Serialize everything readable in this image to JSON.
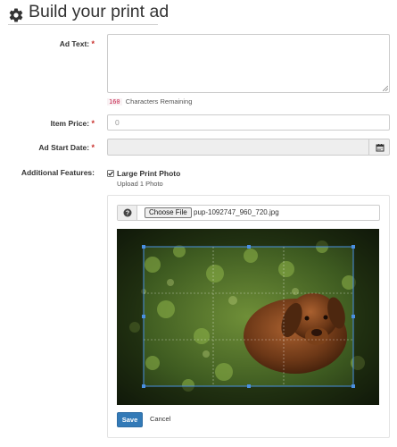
{
  "header": {
    "title": "Build your print ad",
    "icon": "gear-icon"
  },
  "form": {
    "ad_text": {
      "label": "Ad Text:",
      "required_mark": "*",
      "value": ""
    },
    "counter": {
      "count": "160",
      "text": "Characters Remaining"
    },
    "item_price": {
      "label": "Item Price:",
      "required_mark": "*",
      "placeholder": "0"
    },
    "ad_start_date": {
      "label": "Ad Start Date:",
      "required_mark": "*",
      "icon": "calendar-icon"
    },
    "additional_features": {
      "label": "Additional Features:",
      "option_label": "Large Print Photo",
      "option_checked": true,
      "option_note": "Upload 1 Photo"
    },
    "upload": {
      "help_icon": "question-circle-icon",
      "choose_label": "Choose File",
      "file_name": "pup-1092747_960_720.jpg"
    },
    "actions": {
      "save_label": "Save",
      "cancel_label": "Cancel"
    }
  },
  "colors": {
    "required": "#c9302c",
    "primary": "#337ab7",
    "crop_line": "#4a90e2"
  }
}
